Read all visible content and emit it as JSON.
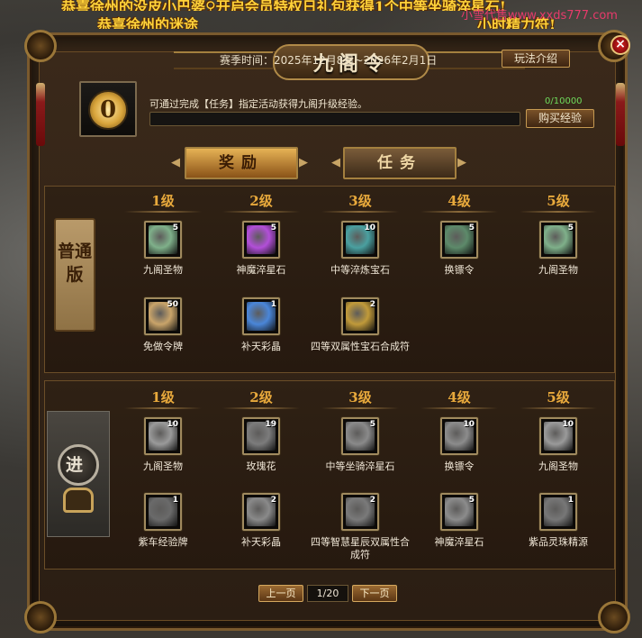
{
  "announcements": {
    "line1": "恭喜徐州的没皮小巴婆♀开启会员特权日礼包获得1个中等坐骑淬星石!",
    "line2": "恭喜徐州的迷途",
    "line3": "小时精力符!"
  },
  "watermark": "小雪代售www.xxds777.com",
  "window": {
    "title": "九阁令",
    "close_label": "×",
    "season_text": "赛季时间：2025年12月8日~2026年2月1日",
    "rules_button": "玩法介绍"
  },
  "progress": {
    "level": "0",
    "hint": "可通过完成【任务】指定活动获得九阁升级经验。",
    "exp_text": "0/10000",
    "exp_fraction": 0,
    "buy_button": "购买经验"
  },
  "tabs": [
    {
      "label": "奖励",
      "active": true
    },
    {
      "label": "任务",
      "active": false
    }
  ],
  "normal_track": {
    "label": "普通版",
    "levels": [
      "1级",
      "2级",
      "3级",
      "4级",
      "5级"
    ],
    "row1": [
      {
        "name": "九阁圣物",
        "qty": "5",
        "icon": "jade-relic-icon",
        "color": "#7fb08a"
      },
      {
        "name": "神魔淬星石",
        "qty": "5",
        "icon": "star-crystal-icon",
        "color": "#b24fd8"
      },
      {
        "name": "中等淬炼宝石",
        "qty": "10",
        "icon": "gem-icon",
        "color": "#4aa0a0"
      },
      {
        "name": "换镖令",
        "qty": "5",
        "icon": "token-coin-icon",
        "color": "#5d8a6a"
      },
      {
        "name": "九阁圣物",
        "qty": "5",
        "icon": "jade-relic-icon",
        "color": "#7fb08a"
      }
    ],
    "row2": [
      {
        "name": "免做令牌",
        "qty": "50",
        "icon": "scroll-icon",
        "color": "#c9a46a"
      },
      {
        "name": "补天彩晶",
        "qty": "1",
        "icon": "crystal-icon",
        "color": "#4a86d8"
      },
      {
        "name": "四等双属性宝石合成符",
        "qty": "2",
        "icon": "talisman-icon",
        "color": "#c09a3a"
      }
    ]
  },
  "advanced_track": {
    "label": "进",
    "levels": [
      "1级",
      "2级",
      "3级",
      "4级",
      "5级"
    ],
    "row1": [
      {
        "name": "九阁圣物",
        "qty": "10",
        "icon": "jade-relic-icon",
        "color": "#9a9a9a"
      },
      {
        "name": "玫瑰花",
        "qty": "19",
        "icon": "rose-icon",
        "color": "#7c7c7c"
      },
      {
        "name": "中等坐骑淬星石",
        "qty": "5",
        "icon": "star-crystal-icon",
        "color": "#8a8a8a"
      },
      {
        "name": "换镖令",
        "qty": "10",
        "icon": "token-coin-icon",
        "color": "#8c8c8c"
      },
      {
        "name": "九阁圣物",
        "qty": "10",
        "icon": "jade-relic-icon",
        "color": "#9a9a9a"
      }
    ],
    "row2": [
      {
        "name": "紫车经验牌",
        "qty": "1",
        "icon": "exp-card-icon",
        "color": "#6a6a6a"
      },
      {
        "name": "补天彩晶",
        "qty": "2",
        "icon": "crystal-icon",
        "color": "#8a8a8a"
      },
      {
        "name": "四等智慧星辰双属性合成符",
        "qty": "2",
        "icon": "talisman-icon",
        "color": "#7a7a7a"
      },
      {
        "name": "神魔淬星石",
        "qty": "5",
        "icon": "star-crystal-icon",
        "color": "#8c8c8c"
      },
      {
        "name": "紫品灵珠精源",
        "qty": "1",
        "icon": "orb-icon",
        "color": "#777777"
      }
    ]
  },
  "pagination": {
    "prev": "上一页",
    "indicator": "1/20",
    "next": "下一页"
  }
}
